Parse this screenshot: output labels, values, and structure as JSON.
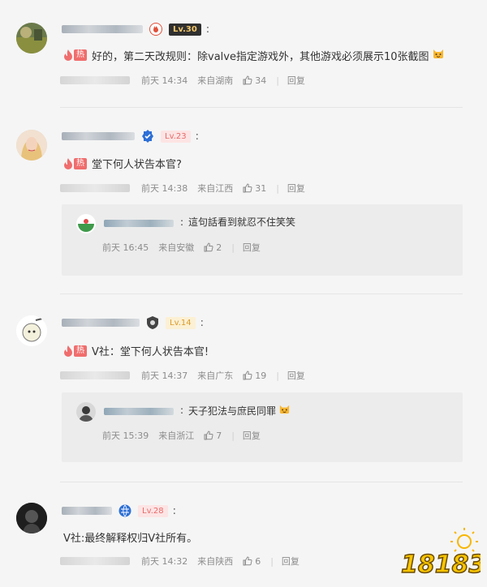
{
  "comments": [
    {
      "level": "Lv.30",
      "hot_label": "热",
      "text": "好的，第二天改规则：除valve指定游戏外，其他游戏必须展示10张截图",
      "time": "前天 14:34",
      "location": "来自湖南",
      "likes": "34",
      "reply_label": "回复"
    },
    {
      "level": "Lv.23",
      "hot_label": "热",
      "text": "堂下何人状告本官?",
      "time": "前天 14:38",
      "location": "来自江西",
      "likes": "31",
      "reply_label": "回复",
      "reply": {
        "text": "這句話看到就忍不住笑笑",
        "time": "前天 16:45",
        "location": "来自安徽",
        "likes": "2",
        "reply_label": "回复"
      }
    },
    {
      "level": "Lv.14",
      "hot_label": "热",
      "text": "V社：堂下何人状告本官!",
      "time": "前天 14:37",
      "location": "来自广东",
      "likes": "19",
      "reply_label": "回复",
      "reply": {
        "text": "天子犯法与庶民同罪",
        "time": "前天 15:39",
        "location": "来自浙江",
        "likes": "7",
        "reply_label": "回复"
      }
    },
    {
      "level": "Lv.28",
      "text": "V社:最终解释权归V社所有。",
      "time": "前天 14:32",
      "location": "来自陕西",
      "likes": "6",
      "reply_label": "回复"
    }
  ],
  "watermark": "18183",
  "colors": {
    "hot": "#f06d6d",
    "meta": "#8c8c8c",
    "background": "#f5f5f5",
    "reply_bg": "#ececec"
  }
}
